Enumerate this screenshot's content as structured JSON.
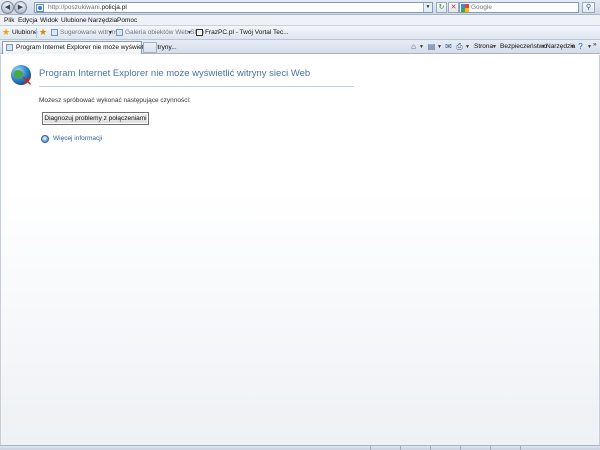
{
  "address_bar": {
    "url_prefix": "http://poszukiwani.",
    "url_domain": "policja.pl",
    "refresh_icon": "refresh-icon",
    "stop_icon": "stop-icon"
  },
  "search": {
    "placeholder": "Google",
    "engine_icon": "google-icon"
  },
  "menu": {
    "items": [
      "Plik",
      "Edycja",
      "Widok",
      "Ulubione",
      "Narzędzia",
      "Pomoc"
    ]
  },
  "favorites_bar": {
    "favorites_label": "Ulubione",
    "items": [
      {
        "label": "Sugerowane witryny",
        "muted": true
      },
      {
        "label": "Galeria obiektów Web Slice",
        "muted": true
      },
      {
        "label": "FrazPC.pl - Twój Vortal Tec...",
        "muted": false
      }
    ]
  },
  "tabs": [
    {
      "label": "Program Internet Explorer nie może wyświetlić witryny...",
      "active": true
    }
  ],
  "command_bar": {
    "items": [
      "Strona",
      "Bezpieczeństwo",
      "Narzędzia"
    ],
    "help_icon": "help-icon"
  },
  "error_page": {
    "title": "Program Internet Explorer nie może wyświetlić witryny sieci Web",
    "hint": "Możesz spróbować wykonać następujące czynności:",
    "diagnose_button": "Diagnozuj problemy z połączeniami",
    "more_info_link": "Więcej informacji"
  },
  "colors": {
    "title_blue": "#4a72a8",
    "link_blue": "#2c5ea8"
  }
}
